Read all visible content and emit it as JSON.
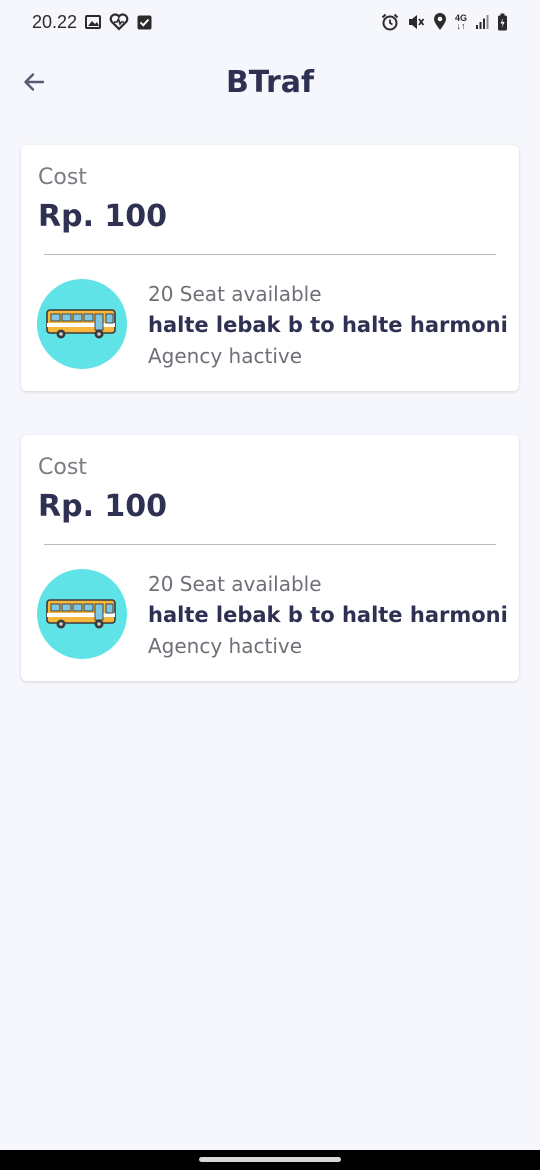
{
  "status": {
    "time": "20.22",
    "network": [
      "4G",
      "↓↑"
    ]
  },
  "appbar": {
    "title": "BTraf"
  },
  "routes": [
    {
      "cost_label": "Cost",
      "cost_value": "Rp. 100",
      "seats": "20 Seat available",
      "route": "halte lebak b to halte harmoni",
      "agency": "Agency hactive"
    },
    {
      "cost_label": "Cost",
      "cost_value": "Rp. 100",
      "seats": "20 Seat available",
      "route": "halte lebak b to halte harmoni",
      "agency": "Agency hactive"
    }
  ],
  "icons": {
    "back": "arrow-left-icon",
    "bus": "bus-icon",
    "gallery": "image-icon",
    "health": "heart-pulse-icon",
    "task": "checkbox-icon",
    "alarm": "alarm-icon",
    "mute": "mute-icon",
    "location": "location-pin-icon",
    "signal": "signal-icon",
    "battery": "battery-icon"
  },
  "colors": {
    "background": "#f6f7fc",
    "avatar": "#5fe3e6",
    "title": "#2f3152"
  }
}
